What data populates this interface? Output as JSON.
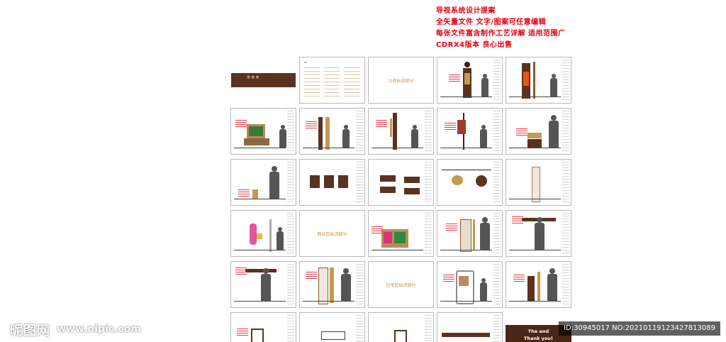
{
  "header": {
    "line1": "导视系统设计提案",
    "line2": "全矢量文件  文字/图案可任意编辑",
    "line3": "每张文件富含制作工艺详解  适用范围广",
    "line4": "CDRX4版本  良心出售"
  },
  "tiles": {
    "public_section": "公共标识部分",
    "commercial_section": "商业区标识部分",
    "residential_section": "住宅区标识部分",
    "end_title": "The end",
    "end_thanks": "Thank you!"
  },
  "watermark": {
    "logo": "昵图网",
    "url": "www.nipic.com",
    "id": "ID:30945017 NO:20210119123427813089"
  },
  "colors": {
    "header_red": "#e60012",
    "sign_brown": "#5a3220",
    "sign_gold": "#c79a52",
    "section_text": "#c58a3a"
  }
}
